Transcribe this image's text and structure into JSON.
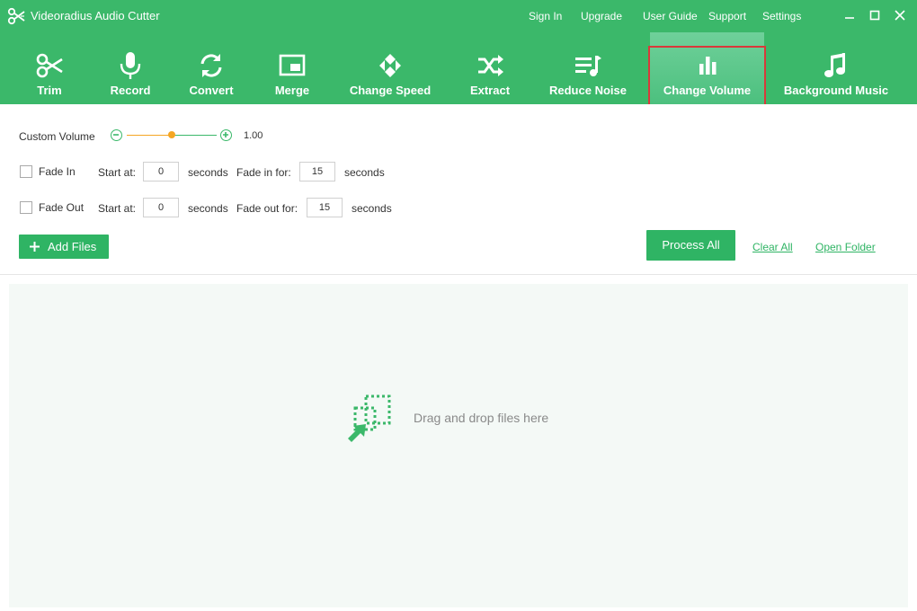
{
  "app": {
    "title": "Videoradius Audio Cutter",
    "logo_icon": "scissors-logo-icon"
  },
  "top_links": [
    {
      "label": "Sign In"
    },
    {
      "label": "Upgrade"
    },
    {
      "label": "User Guide"
    },
    {
      "label": "Support"
    },
    {
      "label": "Settings"
    }
  ],
  "toolbar": [
    {
      "label": "Trim",
      "icon": "scissors-icon"
    },
    {
      "label": "Record",
      "icon": "microphone-icon"
    },
    {
      "label": "Convert",
      "icon": "refresh-icon"
    },
    {
      "label": "Merge",
      "icon": "picture-in-picture-icon"
    },
    {
      "label": "Change Speed",
      "icon": "dpad-icon"
    },
    {
      "label": "Extract",
      "icon": "shuffle-icon"
    },
    {
      "label": "Reduce Noise",
      "icon": "playlist-icon"
    },
    {
      "label": "Change Volume",
      "icon": "bar-chart-icon",
      "active": true
    },
    {
      "label": "Background Music",
      "icon": "music-note-icon"
    }
  ],
  "volume": {
    "label": "Custom Volume",
    "value": "1.00",
    "level_fraction": 0.5
  },
  "fade_in": {
    "label": "Fade In",
    "start_label": "Start at:",
    "start_value": "0",
    "seconds1": "seconds",
    "dur_label": "Fade in for:",
    "dur_value": "15",
    "seconds2": "seconds",
    "checked": false
  },
  "fade_out": {
    "label": "Fade Out",
    "start_label": "Start at:",
    "start_value": "0",
    "seconds1": "seconds",
    "dur_label": "Fade out for:",
    "dur_value": "15",
    "seconds2": "seconds",
    "checked": false
  },
  "actions": {
    "add_files": "Add Files",
    "process_all": "Process All",
    "clear_all": "Clear All",
    "open_folder": "Open Folder"
  },
  "dropzone": {
    "text": "Drag and drop files here"
  },
  "colors": {
    "brand": "#3bb86a",
    "button": "#2fb464",
    "slider_left": "#f5a623",
    "highlight": "#d9393a"
  }
}
